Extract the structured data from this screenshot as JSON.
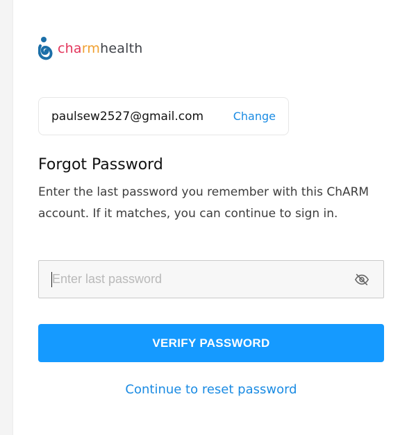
{
  "brand": {
    "logo_part1": "cha",
    "logo_part2": "rm",
    "logo_part3": "health",
    "colors": {
      "red": "#e2345a",
      "orange": "#f0a030",
      "dark": "#3f4248",
      "logo_mark": "#1b6fa8"
    }
  },
  "account": {
    "email": "paulsew2527@gmail.com",
    "change_label": "Change"
  },
  "form": {
    "title": "Forgot Password",
    "description": "Enter the last password you remember with this ChARM account. If it matches, you can continue to sign in.",
    "password_placeholder": "Enter last password",
    "password_value": "",
    "toggle_icon": "eye-slash-icon",
    "verify_button_label": "VERIFY PASSWORD",
    "reset_link_label": "Continue to reset password"
  },
  "theme": {
    "accent": "#159aff",
    "link": "#1a8be3"
  }
}
